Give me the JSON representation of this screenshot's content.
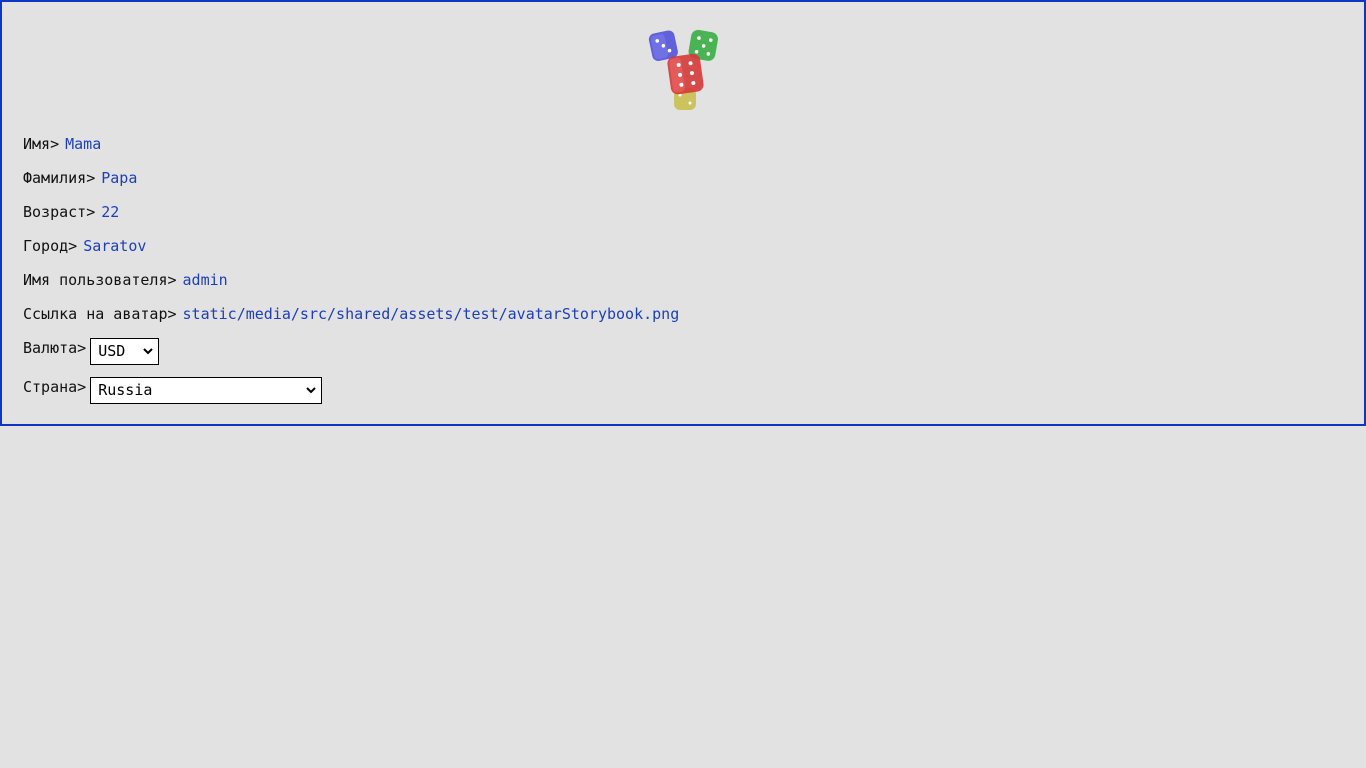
{
  "profile": {
    "avatar_alt": "dice-icon",
    "fields": [
      {
        "label": "Имя>",
        "value": "Mama"
      },
      {
        "label": "Фамилия>",
        "value": "Papa"
      },
      {
        "label": "Возраст>",
        "value": "22"
      },
      {
        "label": "Город>",
        "value": "Saratov"
      },
      {
        "label": "Имя пользователя>",
        "value": "admin"
      },
      {
        "label": "Ссылка на аватар>",
        "value": "static/media/src/shared/assets/test/avatarStorybook.png"
      }
    ],
    "currency": {
      "label": "Валюта>",
      "selected": "USD"
    },
    "country": {
      "label": "Страна>",
      "selected": "Russia"
    }
  },
  "colors": {
    "border": "#0f35c4",
    "value_text": "#1d3fb8",
    "background": "#e2e2e2"
  }
}
